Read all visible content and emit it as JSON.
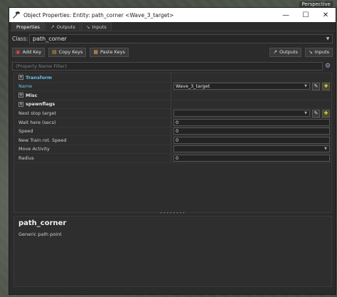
{
  "viewport": {
    "corner_label": "Perspective"
  },
  "window": {
    "title": "Object Properties: Entity: path_corner <Wave_3_target>",
    "app_icon": "hammer-icon",
    "controls": {
      "minimize": "—",
      "maximize": "☐",
      "close": "✕"
    }
  },
  "tabs": [
    {
      "label": "Properties",
      "active": true
    },
    {
      "label": "Outputs",
      "icon": "output-arrow-icon"
    },
    {
      "label": "Inputs",
      "icon": "input-arrow-icon"
    }
  ],
  "class_row": {
    "label": "Class:",
    "value": "path_corner"
  },
  "toolbar": {
    "add_key": "Add Key",
    "copy_keys": "Copy Keys",
    "paste_keys": "Paste Keys",
    "outputs": "Outputs",
    "inputs": "Inputs"
  },
  "filter": {
    "placeholder": "(Property Name Filter)"
  },
  "properties": {
    "groups": {
      "transform": "Transform",
      "misc": "Misc",
      "spawnflags": "spawnflags"
    },
    "name": {
      "label": "Name",
      "value": "Wave_3_target"
    },
    "next_stop_target": {
      "label": "Next stop target",
      "value": ""
    },
    "wait_here": {
      "label": "Wait here (secs)",
      "value": "0"
    },
    "speed": {
      "label": "Speed",
      "value": "0"
    },
    "new_train_rot_speed": {
      "label": "New Train rot. Speed",
      "value": "0"
    },
    "move_activity": {
      "label": "Move Activity",
      "value": ""
    },
    "radius": {
      "label": "Radius",
      "value": "0"
    }
  },
  "description": {
    "title": "path_corner",
    "text": "Generic path point"
  },
  "colors": {
    "accent": "#6ac2e8",
    "background": "#2b2b2b"
  }
}
